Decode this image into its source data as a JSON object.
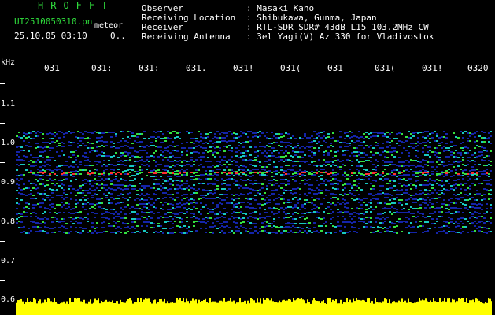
{
  "header": {
    "brand": "HROFFT",
    "file_name": "UT2510050310.pn",
    "file_suffix": "meteor",
    "datetime": "25.10.05 03:10",
    "counter": "0.."
  },
  "info": [
    {
      "label": "Observer",
      "value": ": Masaki Kano"
    },
    {
      "label": "Receiving Location",
      "value": ": Shibukawa, Gunma, Japan"
    },
    {
      "label": "Receiver",
      "value": ": RTL-SDR SDR# 43dB L15 103.2MHz CW"
    },
    {
      "label": "Receiving Antenna",
      "value": ": 3el Yagi(V) Az 330 for Vladivostok"
    }
  ],
  "axis": {
    "unit": "kHz",
    "time_labels": [
      "031",
      "031:",
      "031:",
      "031.",
      "031!",
      "031(",
      "031",
      "031(",
      "031!",
      "0320"
    ],
    "freq_labels": [
      "1.1",
      "1.0",
      "0.9",
      "0.8",
      "0.7",
      "0.6"
    ]
  },
  "colors": {
    "brand": "#2fdc3c",
    "background": "#000000",
    "signal_band": "#ff3030",
    "amplitude": "#ffff00",
    "noise_low": "#1424a8",
    "noise_mid": "#18c8c0",
    "noise_high": "#34e040"
  }
}
